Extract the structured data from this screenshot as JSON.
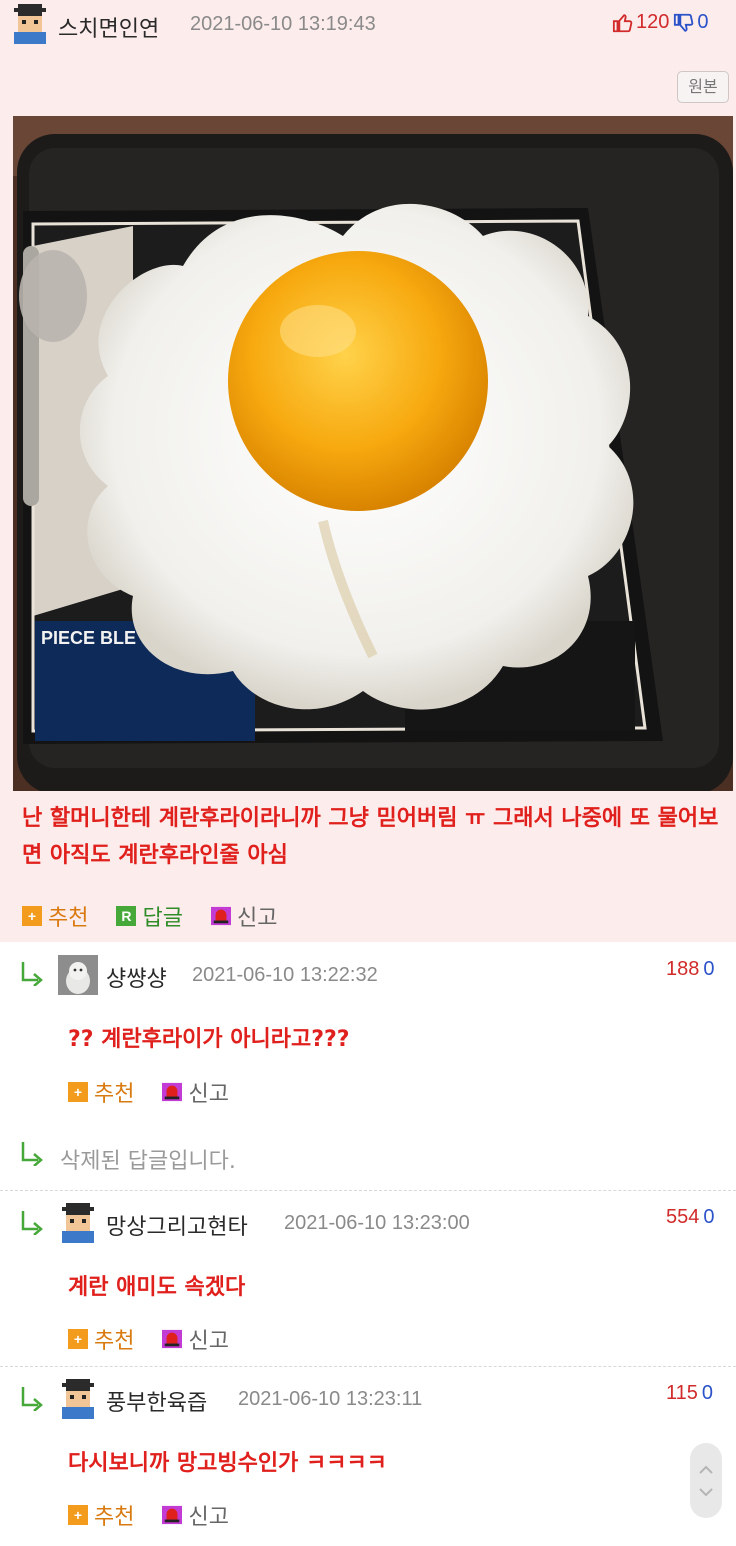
{
  "post": {
    "author": "스치면인연",
    "date": "2021-06-10 13:19:43",
    "upvotes": "120",
    "downvotes": "0",
    "original_button": "원본",
    "text": "난 할머니한테 계란후라이라니까 그냥 믿어버림 ㅠ 그래서 나중에 또 물어보면 아직도 계란후라인줄 아심",
    "actions": {
      "recommend": "추천",
      "reply": "답글",
      "report": "신고",
      "reply_icon_letter": "R"
    }
  },
  "comments": [
    {
      "author": "샹썅샹",
      "date": "2021-06-10 13:22:32",
      "up": "188",
      "down": "0",
      "text": "?? 계란후라이가 아니라고???",
      "recommend": "추천",
      "report": "신고"
    },
    {
      "deleted_text": "삭제된 답글입니다."
    },
    {
      "author": "망상그리고현타",
      "date": "2021-06-10 13:23:00",
      "up": "554",
      "down": "0",
      "text": "계란 애미도 속겠다",
      "recommend": "추천",
      "report": "신고"
    },
    {
      "author": "풍부한육즙",
      "date": "2021-06-10 13:23:11",
      "up": "115",
      "down": "0",
      "text": "다시보니까 망고빙수인가 ㅋㅋㅋㅋ",
      "recommend": "추천",
      "report": "신고"
    }
  ],
  "colors": {
    "accent": "#e0201c",
    "post_bg": "#fdecec",
    "up": "#d12b2b",
    "down": "#2b52c9",
    "recommend": "#d97a10",
    "reply": "#2f8c28"
  }
}
